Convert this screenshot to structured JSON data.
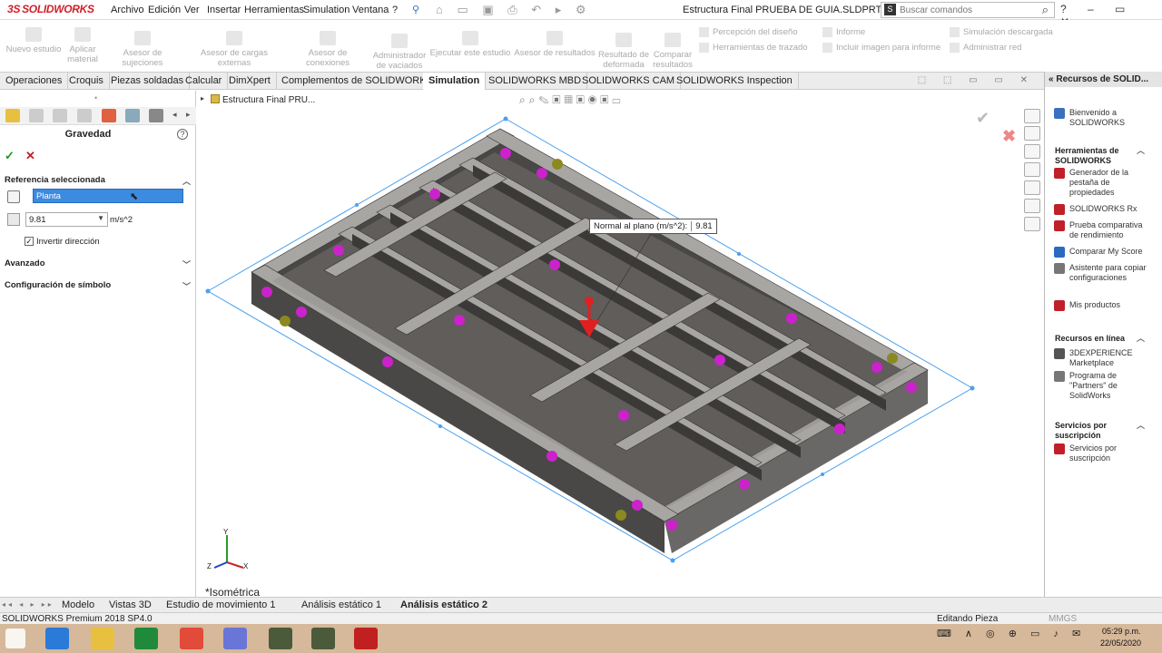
{
  "menubar": {
    "logo_text": "SOLIDWORKS",
    "logo_prefix": "3S",
    "items": [
      "Archivo",
      "Edición",
      "Ver",
      "Insertar",
      "Herramientas",
      "Simulation",
      "Ventana",
      "?"
    ],
    "doc_title": "Estructura Final PRUEBA DE GUIA.SLDPRT *",
    "search_placeholder": "Buscar comandos",
    "pin_icon": "pin-icon"
  },
  "command_manager": {
    "items": [
      {
        "label": "Nuevo estudio",
        "sub": ""
      },
      {
        "label": "Aplicar",
        "sub": "material"
      },
      {
        "label": "Asesor de sujeciones",
        "sub": ""
      },
      {
        "label": "Asesor de cargas externas",
        "sub": ""
      },
      {
        "label": "Asesor de conexiones",
        "sub": ""
      },
      {
        "label": "Administrador",
        "sub": "de vaciados"
      },
      {
        "label": "Ejecutar este estudio",
        "sub": ""
      },
      {
        "label": "Asesor de resultados",
        "sub": ""
      },
      {
        "label": "Resultado de",
        "sub": "deformada"
      },
      {
        "label": "Comparar",
        "sub": "resultados"
      }
    ],
    "small_items": [
      "Percepción del diseño",
      "Herramientas de trazado",
      "Informe",
      "Incluir imagen para informe",
      "Simulación descargada",
      "Administrar red"
    ]
  },
  "tabs": [
    {
      "label": "Operaciones"
    },
    {
      "label": "Croquis"
    },
    {
      "label": "Piezas soldadas"
    },
    {
      "label": "Calcular"
    },
    {
      "label": "DimXpert"
    },
    {
      "label": "Complementos de SOLIDWORKS"
    },
    {
      "label": "Simulation"
    },
    {
      "label": "SOLIDWORKS MBD"
    },
    {
      "label": "SOLIDWORKS CAM"
    },
    {
      "label": "SOLIDWORKS Inspection"
    }
  ],
  "property_manager": {
    "title": "Gravedad",
    "help": "?",
    "ok": "✓",
    "cancel": "✕",
    "section_reference": "Referencia seleccionada",
    "reference_value": "Planta",
    "gravity_value": "9.81",
    "gravity_unit": "m/s^2",
    "invert_label": "Invertir dirección",
    "invert_checked": "✓",
    "section_advanced": "Avanzado",
    "section_symbol": "Configuración de símbolo"
  },
  "viewport": {
    "tree_label": "Estructura Final PRU...",
    "tooltip_label": "Normal al plano (m/s^2):",
    "tooltip_value": "9.81",
    "view_label": "*Isométrica",
    "axis_x": "X",
    "axis_y": "Y",
    "axis_z": "Z"
  },
  "resources": {
    "header": "Recursos de SOLID...",
    "welcome": "Bienvenido a SOLIDWORKS",
    "tools_section": "Herramientas de SOLIDWORKS",
    "tools": [
      "Generador de la pestaña de propiedades",
      "SOLIDWORKS Rx",
      "Prueba comparativa de rendimiento",
      "Comparar My Score",
      "Asistente para copiar configuraciones",
      "Mis productos"
    ],
    "online_section": "Recursos en línea",
    "online": [
      "3DEXPERIENCE Marketplace",
      "Programa de \"Partners\" de SolidWorks"
    ],
    "subscription_section": "Servicios por suscripción",
    "subscription": [
      "Servicios por suscripción"
    ]
  },
  "bottom_tabs": [
    "Modelo",
    "Vistas 3D",
    "Estudio de movimiento 1",
    "Análisis estático 1",
    "Análisis estático 2"
  ],
  "status": {
    "left": "SOLIDWORKS Premium 2018 SP4.0",
    "mode": "Editando Pieza",
    "units": "MMGS"
  },
  "clock": {
    "time": "05:29 p.m.",
    "date": "22/05/2020"
  },
  "colors": {
    "accent": "#d0202a",
    "selection": "#3b8be0",
    "beam": "#5c5a58",
    "fixture": "#cc22cc",
    "load": "#e02020"
  }
}
